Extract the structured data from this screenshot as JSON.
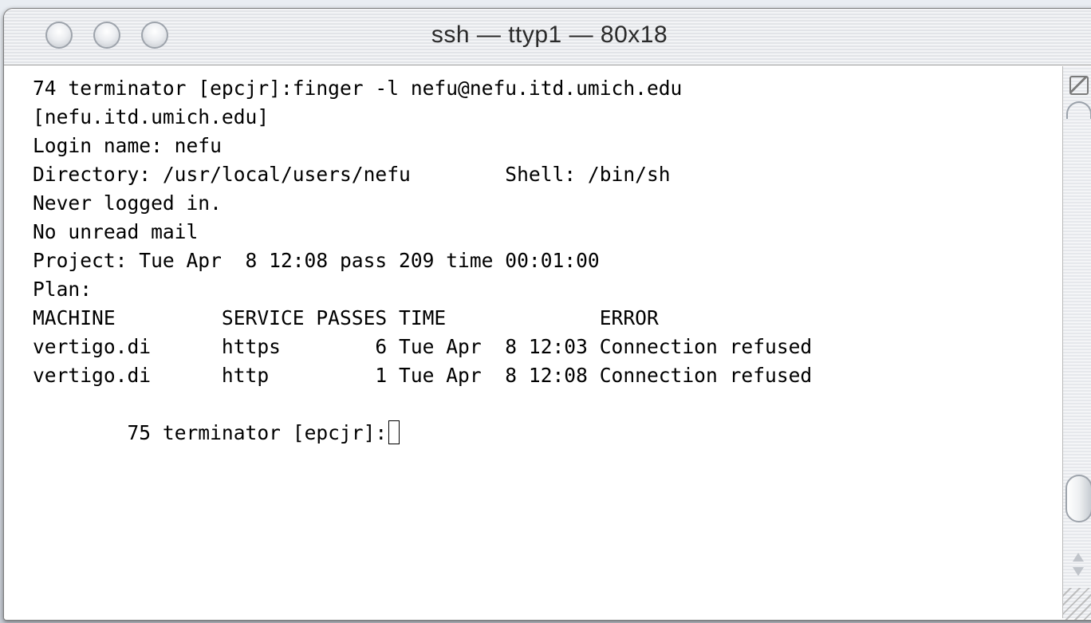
{
  "window": {
    "title": "ssh — ttyp1 — 80x18"
  },
  "terminal": {
    "lines": [
      "74 terminator [epcjr]:finger -l nefu@nefu.itd.umich.edu",
      "[nefu.itd.umich.edu]",
      "Login name: nefu",
      "Directory: /usr/local/users/nefu        Shell: /bin/sh",
      "Never logged in.",
      "No unread mail",
      "Project: Tue Apr  8 12:08 pass 209 time 00:01:00",
      "Plan:",
      "MACHINE         SERVICE PASSES TIME             ERROR",
      "vertigo.di      https        6 Tue Apr  8 12:03 Connection refused",
      "vertigo.di      http         1 Tue Apr  8 12:08 Connection refused"
    ],
    "prompt": "75 terminator [epcjr]:"
  },
  "icons": {
    "close": "close-traffic-light-icon",
    "minimize": "minimize-traffic-light-icon",
    "zoom": "zoom-traffic-light-icon",
    "split": "split-pane-icon",
    "scroll_up": "arrow-up-icon",
    "scroll_down": "arrow-down-icon",
    "resize": "resize-grip-icon"
  }
}
